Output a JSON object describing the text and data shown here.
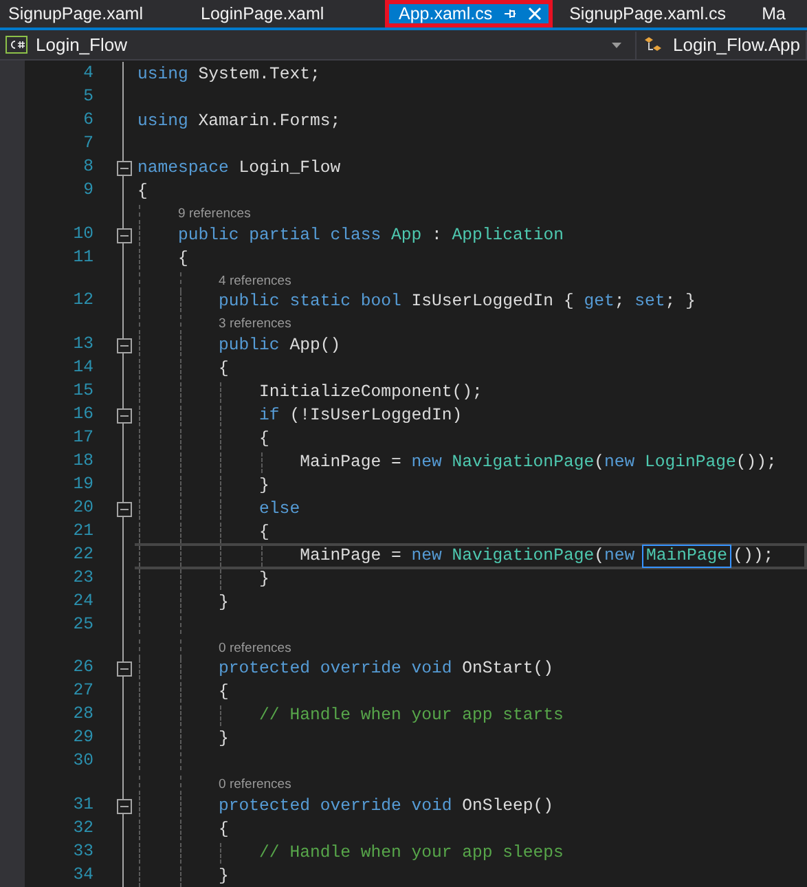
{
  "tabs": [
    {
      "label": "SignupPage.xaml",
      "selected": false,
      "outlined": false
    },
    {
      "label": "LoginPage.xaml",
      "selected": false,
      "outlined": false
    },
    {
      "label": "App.xaml.cs",
      "selected": true,
      "outlined": true
    },
    {
      "label": "SignupPage.xaml.cs",
      "selected": false,
      "outlined": false
    },
    {
      "label": "Ma",
      "selected": false,
      "outlined": false
    }
  ],
  "navigation_bar": {
    "project": "Login_Flow",
    "member": "Login_Flow.App"
  },
  "editor": {
    "lines": [
      {
        "kind": "code",
        "number": "4",
        "fold": false,
        "current": false,
        "tokens": [
          {
            "text": "using",
            "color": "#569cd6"
          },
          {
            "text": " System.Text;",
            "color": "#dcdcdc"
          }
        ]
      },
      {
        "kind": "code",
        "number": "5",
        "fold": false,
        "current": false
      },
      {
        "kind": "code",
        "number": "6",
        "fold": false,
        "current": false,
        "tokens": [
          {
            "text": "using",
            "color": "#569cd6"
          },
          {
            "text": " Xamarin.Forms;",
            "color": "#dcdcdc"
          }
        ]
      },
      {
        "kind": "code",
        "number": "7",
        "fold": false,
        "current": false
      },
      {
        "kind": "code",
        "number": "8",
        "fold": true,
        "current": false,
        "tokens": [
          {
            "text": "namespace",
            "color": "#569cd6"
          },
          {
            "text": " Login_Flow",
            "color": "#dcdcdc"
          }
        ]
      },
      {
        "kind": "code",
        "number": "9",
        "fold": false,
        "current": false,
        "tokens": [
          {
            "text": "{",
            "color": "#dcdcdc"
          }
        ]
      },
      {
        "kind": "lens",
        "text": "9 references"
      },
      {
        "kind": "code",
        "number": "10",
        "fold": true,
        "current": false,
        "tokens": [
          {
            "text": "    public partial class",
            "color": "#569cd6"
          },
          {
            "text": " App",
            "color": "#4ec9b0"
          },
          {
            "text": " : ",
            "color": "#dcdcdc"
          },
          {
            "text": "Application",
            "color": "#4ec9b0"
          }
        ]
      },
      {
        "kind": "code",
        "number": "11",
        "fold": false,
        "current": false,
        "tokens": [
          {
            "text": "    {",
            "color": "#dcdcdc"
          }
        ]
      },
      {
        "kind": "lens",
        "text": "4 references"
      },
      {
        "kind": "code",
        "number": "12",
        "fold": false,
        "current": false,
        "tokens": [
          {
            "text": "        public static bool",
            "color": "#569cd6"
          },
          {
            "text": " IsUserLoggedIn { ",
            "color": "#dcdcdc"
          },
          {
            "text": "get",
            "color": "#569cd6"
          },
          {
            "text": "; ",
            "color": "#dcdcdc"
          },
          {
            "text": "set",
            "color": "#569cd6"
          },
          {
            "text": "; }",
            "color": "#dcdcdc"
          }
        ]
      },
      {
        "kind": "lens",
        "text": "3 references"
      },
      {
        "kind": "code",
        "number": "13",
        "fold": true,
        "current": false,
        "tokens": [
          {
            "text": "        public",
            "color": "#569cd6"
          },
          {
            "text": " App()",
            "color": "#dcdcdc"
          }
        ]
      },
      {
        "kind": "code",
        "number": "14",
        "fold": false,
        "current": false,
        "tokens": [
          {
            "text": "        {",
            "color": "#dcdcdc"
          }
        ]
      },
      {
        "kind": "code",
        "number": "15",
        "fold": false,
        "current": false,
        "tokens": [
          {
            "text": "            InitializeComponent();",
            "color": "#dcdcdc"
          }
        ]
      },
      {
        "kind": "code",
        "number": "16",
        "fold": true,
        "current": false,
        "tokens": [
          {
            "text": "            if",
            "color": "#569cd6"
          },
          {
            "text": " (!IsUserLoggedIn)",
            "color": "#dcdcdc"
          }
        ]
      },
      {
        "kind": "code",
        "number": "17",
        "fold": false,
        "current": false,
        "tokens": [
          {
            "text": "            {",
            "color": "#dcdcdc"
          }
        ]
      },
      {
        "kind": "code",
        "number": "18",
        "fold": false,
        "current": false,
        "tokens": [
          {
            "text": "                MainPage = ",
            "color": "#dcdcdc"
          },
          {
            "text": "new",
            "color": "#569cd6"
          },
          {
            "text": " NavigationPage",
            "color": "#4ec9b0"
          },
          {
            "text": "(",
            "color": "#dcdcdc"
          },
          {
            "text": "new",
            "color": "#569cd6"
          },
          {
            "text": " LoginPage",
            "color": "#4ec9b0"
          },
          {
            "text": "());",
            "color": "#dcdcdc"
          }
        ]
      },
      {
        "kind": "code",
        "number": "19",
        "fold": false,
        "current": false,
        "tokens": [
          {
            "text": "            }",
            "color": "#dcdcdc"
          }
        ]
      },
      {
        "kind": "code",
        "number": "20",
        "fold": true,
        "current": false,
        "tokens": [
          {
            "text": "            else",
            "color": "#569cd6"
          }
        ]
      },
      {
        "kind": "code",
        "number": "21",
        "fold": false,
        "current": false,
        "tokens": [
          {
            "text": "            {",
            "color": "#dcdcdc"
          }
        ]
      },
      {
        "kind": "code",
        "number": "22",
        "fold": false,
        "current": true,
        "tokens": [
          {
            "text": "                MainPage = ",
            "color": "#dcdcdc",
            "highlighted": false
          },
          {
            "text": "new",
            "color": "#569cd6",
            "highlighted": false
          },
          {
            "text": " NavigationPage",
            "color": "#4ec9b0",
            "highlighted": false
          },
          {
            "text": "(",
            "color": "#dcdcdc",
            "highlighted": false
          },
          {
            "text": "new ",
            "color": "#569cd6",
            "highlighted": false
          },
          {
            "text": "MainPage",
            "color": "#4ec9b0",
            "highlighted": true
          },
          {
            "text": "());",
            "color": "#dcdcdc",
            "highlighted": false
          }
        ]
      },
      {
        "kind": "code",
        "number": "23",
        "fold": false,
        "current": false,
        "tokens": [
          {
            "text": "            }",
            "color": "#dcdcdc"
          }
        ]
      },
      {
        "kind": "code",
        "number": "24",
        "fold": false,
        "current": false,
        "tokens": [
          {
            "text": "        }",
            "color": "#dcdcdc"
          }
        ]
      },
      {
        "kind": "code",
        "number": "25",
        "fold": false,
        "current": false
      },
      {
        "kind": "lens",
        "text": "0 references"
      },
      {
        "kind": "code",
        "number": "26",
        "fold": true,
        "current": false,
        "tokens": [
          {
            "text": "        protected override void",
            "color": "#569cd6"
          },
          {
            "text": " OnStart()",
            "color": "#dcdcdc"
          }
        ]
      },
      {
        "kind": "code",
        "number": "27",
        "fold": false,
        "current": false,
        "tokens": [
          {
            "text": "        {",
            "color": "#dcdcdc"
          }
        ]
      },
      {
        "kind": "code",
        "number": "28",
        "fold": false,
        "current": false,
        "tokens": [
          {
            "text": "            // Handle when your app starts",
            "color": "#57a64a"
          }
        ]
      },
      {
        "kind": "code",
        "number": "29",
        "fold": false,
        "current": false,
        "tokens": [
          {
            "text": "        }",
            "color": "#dcdcdc"
          }
        ]
      },
      {
        "kind": "code",
        "number": "30",
        "fold": false,
        "current": false
      },
      {
        "kind": "lens",
        "text": "0 references"
      },
      {
        "kind": "code",
        "number": "31",
        "fold": true,
        "current": false,
        "tokens": [
          {
            "text": "        protected override void",
            "color": "#569cd6"
          },
          {
            "text": " OnSleep()",
            "color": "#dcdcdc"
          }
        ]
      },
      {
        "kind": "code",
        "number": "32",
        "fold": false,
        "current": false,
        "tokens": [
          {
            "text": "        {",
            "color": "#dcdcdc"
          }
        ]
      },
      {
        "kind": "code",
        "number": "33",
        "fold": false,
        "current": false,
        "tokens": [
          {
            "text": "            // Handle when your app sleeps",
            "color": "#57a64a"
          }
        ]
      },
      {
        "kind": "code",
        "number": "34",
        "fold": false,
        "current": false,
        "tokens": [
          {
            "text": "        }",
            "color": "#dcdcdc"
          }
        ]
      }
    ]
  }
}
